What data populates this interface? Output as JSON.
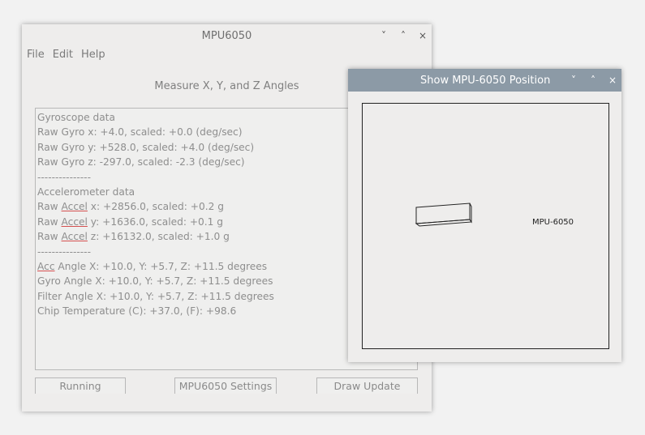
{
  "main_window": {
    "title": "MPU6050",
    "controls": {
      "minimize": "˅",
      "maximize": "˄",
      "close": "×"
    },
    "menu": [
      "File",
      "Edit",
      "Help"
    ],
    "heading": "Measure X, Y, and Z Angles",
    "output_lines": [
      "Gyroscope data",
      "Raw Gyro x: +4.0, scaled: +0.0 (deg/sec)",
      "Raw Gyro y: +528.0, scaled: +4.0 (deg/sec)",
      "Raw Gyro z: -297.0, scaled: -2.3 (deg/sec)",
      "---------------",
      "Accelerometer data",
      "Raw Accel x: +2856.0, scaled: +0.2 g",
      "Raw Accel y: +1636.0, scaled: +0.1 g",
      "Raw Accel z: +16132.0, scaled: +1.0 g",
      "---------------",
      "Acc Angle X: +10.0, Y: +5.7, Z: +11.5 degrees",
      "Gyro Angle X: +10.0, Y: +5.7, Z: +11.5 degrees",
      "Filter Angle X: +10.0, Y: +5.7, Z: +11.5 degrees",
      "Chip Temperature (C): +37.0, (F): +98.6"
    ],
    "spellcheck_words": [
      "Accel",
      "Acc"
    ],
    "buttons": {
      "running": "Running",
      "settings": "MPU6050 Settings",
      "draw_update": "Draw Update"
    }
  },
  "position_window": {
    "title": "Show MPU-6050 Position",
    "controls": {
      "minimize": "˅",
      "maximize": "˄",
      "close": "×"
    },
    "label": "MPU-6050",
    "titlebar_color": "#8c9aa6"
  }
}
